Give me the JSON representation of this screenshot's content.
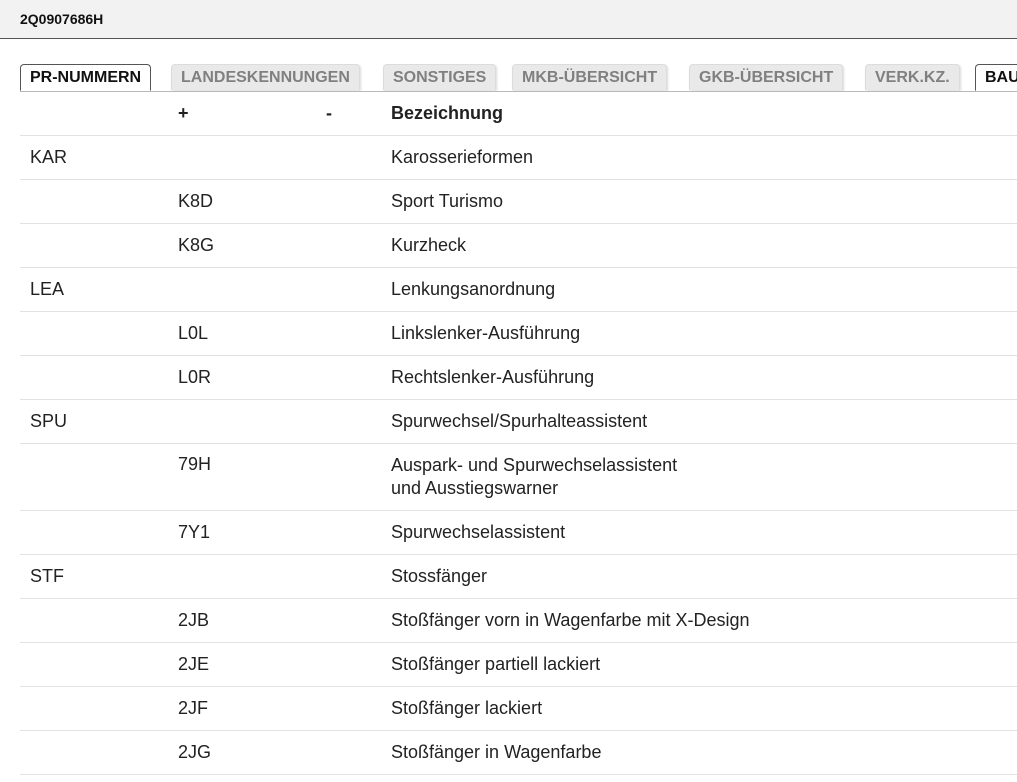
{
  "header": {
    "part_number": "2Q0907686H"
  },
  "tabs": [
    {
      "label": "PR-NUMMERN",
      "active": true
    },
    {
      "label": "LANDESKENNUNGEN",
      "active": false
    },
    {
      "label": "SONSTIGES",
      "active": false
    },
    {
      "label": "MKB-ÜBERSICHT",
      "active": false
    },
    {
      "label": "GKB-ÜBERSICHT",
      "active": false
    },
    {
      "label": "VERK.KZ.",
      "active": false
    },
    {
      "label": "BAU",
      "active": false
    }
  ],
  "table": {
    "columns": {
      "group": "",
      "plus": "+",
      "minus": "-",
      "description": "Bezeichnung"
    },
    "rows": [
      {
        "group": "KAR",
        "plus": "",
        "minus": "",
        "description": "Karosserieformen"
      },
      {
        "group": "",
        "plus": "K8D",
        "minus": "",
        "description": "Sport Turismo"
      },
      {
        "group": "",
        "plus": "K8G",
        "minus": "",
        "description": "Kurzheck"
      },
      {
        "group": "LEA",
        "plus": "",
        "minus": "",
        "description": "Lenkungsanordnung"
      },
      {
        "group": "",
        "plus": "L0L",
        "minus": "",
        "description": "Linkslenker-Ausführung"
      },
      {
        "group": "",
        "plus": "L0R",
        "minus": "",
        "description": "Rechtslenker-Ausführung"
      },
      {
        "group": "SPU",
        "plus": "",
        "minus": "",
        "description": "Spurwechsel/Spurhalteassistent"
      },
      {
        "group": "",
        "plus": "79H",
        "minus": "",
        "description": "Auspark- und Spurwechselassistent\nund Ausstiegswarner"
      },
      {
        "group": "",
        "plus": "7Y1",
        "minus": "",
        "description": "Spurwechselassistent"
      },
      {
        "group": "STF",
        "plus": "",
        "minus": "",
        "description": "Stossfänger"
      },
      {
        "group": "",
        "plus": "2JB",
        "minus": "",
        "description": "Stoßfänger vorn in Wagenfarbe mit X-Design"
      },
      {
        "group": "",
        "plus": "2JE",
        "minus": "",
        "description": "Stoßfänger partiell lackiert"
      },
      {
        "group": "",
        "plus": "2JF",
        "minus": "",
        "description": "Stoßfänger lackiert"
      },
      {
        "group": "",
        "plus": "2JG",
        "minus": "",
        "description": "Stoßfänger in Wagenfarbe"
      }
    ]
  }
}
